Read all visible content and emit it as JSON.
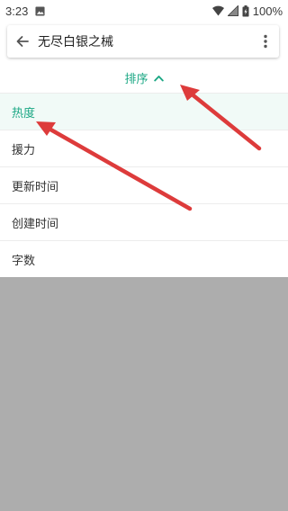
{
  "status_bar": {
    "time": "3:23",
    "battery": "100%"
  },
  "toolbar": {
    "back_icon": "arrow-back-icon",
    "title": "无尽白银之械",
    "more_icon": "more-vertical-icon"
  },
  "sort": {
    "label": "排序",
    "chevron_icon": "chevron-up-icon",
    "options": [
      {
        "label": "热度",
        "selected": true
      },
      {
        "label": "援力",
        "selected": false
      },
      {
        "label": "更新时间",
        "selected": false
      },
      {
        "label": "创建时间",
        "selected": false
      },
      {
        "label": "字数",
        "selected": false
      }
    ]
  },
  "colors": {
    "accent": "#1ba784",
    "selected_bg": "#f1faf7",
    "scrim": "#adadad",
    "annotation_arrow": "#dd3b3b"
  }
}
